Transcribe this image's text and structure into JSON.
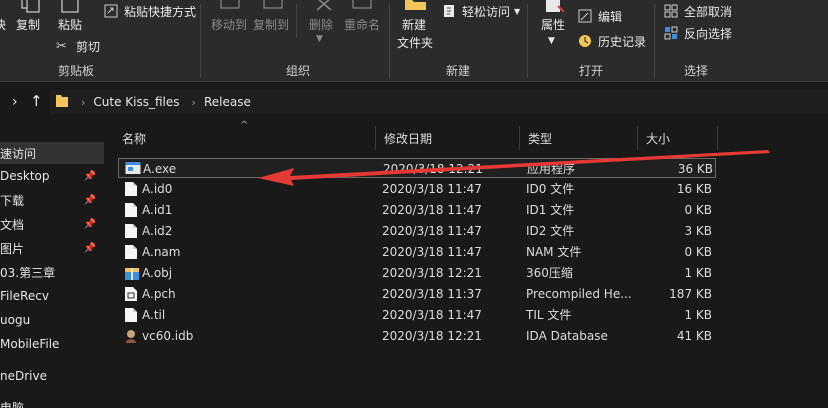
{
  "ribbon": {
    "clipboard": {
      "pin_label": "快",
      "copy_label": "复制",
      "paste_label": "粘贴",
      "paste_shortcut_label": "粘贴快捷方式",
      "cut_label": "剪切",
      "group_label": "剪贴板"
    },
    "organize": {
      "move_to_label": "移动到",
      "copy_to_label": "复制到",
      "delete_label": "删除",
      "rename_label": "重命名",
      "group_label": "组织"
    },
    "new": {
      "new_folder_line1": "新建",
      "new_folder_line2": "文件夹",
      "easy_access_label": "轻松访问",
      "group_label": "新建"
    },
    "open": {
      "properties_label": "属性",
      "edit_label": "编辑",
      "history_label": "历史记录",
      "group_label": "打开"
    },
    "select": {
      "select_none_label": "全部取消",
      "invert_label": "反向选择",
      "group_label": "选择"
    }
  },
  "address": {
    "crumbs": [
      "Cute Kiss_files",
      "Release"
    ]
  },
  "nav": {
    "items": [
      {
        "label": "速访问",
        "pinned": false,
        "active": true
      },
      {
        "label": "Desktop",
        "pinned": true,
        "active": false
      },
      {
        "label": "下载",
        "pinned": true,
        "active": false
      },
      {
        "label": "文档",
        "pinned": true,
        "active": false
      },
      {
        "label": "图片",
        "pinned": true,
        "active": false
      },
      {
        "label": "03.第三章",
        "pinned": false,
        "active": false
      },
      {
        "label": "FileRecv",
        "pinned": false,
        "active": false
      },
      {
        "label": "uogu",
        "pinned": false,
        "active": false
      },
      {
        "label": "MobileFile",
        "pinned": false,
        "active": false
      },
      {
        "label": "neDrive",
        "pinned": false,
        "active": false
      },
      {
        "label": "电脑",
        "pinned": false,
        "active": false
      }
    ]
  },
  "columns": {
    "name": "名称",
    "modified": "修改日期",
    "type": "类型",
    "size": "大小"
  },
  "files": [
    {
      "name": "A.exe",
      "modified": "2020/3/18 12:21",
      "type": "应用程序",
      "size": "36 KB",
      "icon": "exe-icon",
      "selected": true
    },
    {
      "name": "A.id0",
      "modified": "2020/3/18 11:47",
      "type": "ID0 文件",
      "size": "16 KB",
      "icon": "file-icon",
      "selected": false
    },
    {
      "name": "A.id1",
      "modified": "2020/3/18 11:47",
      "type": "ID1 文件",
      "size": "0 KB",
      "icon": "file-icon",
      "selected": false
    },
    {
      "name": "A.id2",
      "modified": "2020/3/18 11:47",
      "type": "ID2 文件",
      "size": "3 KB",
      "icon": "file-icon",
      "selected": false
    },
    {
      "name": "A.nam",
      "modified": "2020/3/18 11:47",
      "type": "NAM 文件",
      "size": "0 KB",
      "icon": "file-icon",
      "selected": false
    },
    {
      "name": "A.obj",
      "modified": "2020/3/18 12:21",
      "type": "360压缩",
      "size": "1 KB",
      "icon": "archive-icon",
      "selected": false
    },
    {
      "name": "A.pch",
      "modified": "2020/3/18 11:37",
      "type": "Precompiled He...",
      "size": "187 KB",
      "icon": "pch-icon",
      "selected": false
    },
    {
      "name": "A.til",
      "modified": "2020/3/18 11:47",
      "type": "TIL 文件",
      "size": "1 KB",
      "icon": "file-icon",
      "selected": false
    },
    {
      "name": "vc60.idb",
      "modified": "2020/3/18 12:21",
      "type": "IDA Database",
      "size": "41 KB",
      "icon": "ida-icon",
      "selected": false
    }
  ],
  "colors": {
    "background": "#191919",
    "ribbon": "#2b2b2b",
    "annotation_arrow": "#e53935",
    "folder": "#f2c45a"
  }
}
